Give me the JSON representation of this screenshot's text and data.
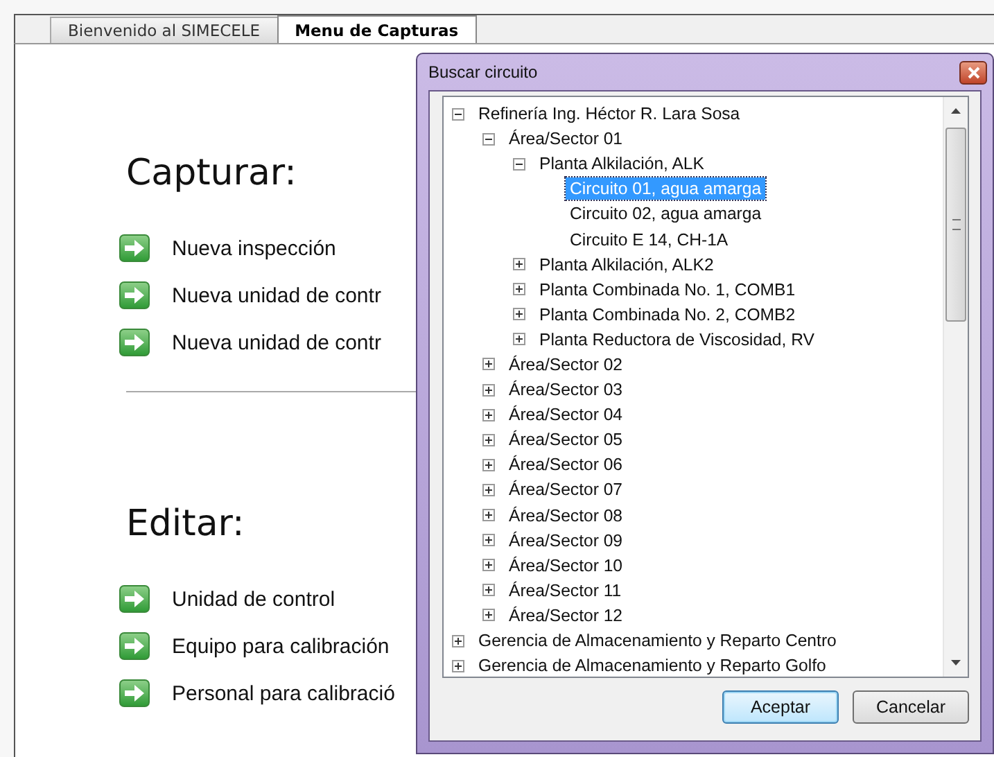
{
  "tabs": [
    {
      "label": "Bienvenido al SIMECELE",
      "selected": false
    },
    {
      "label": "Menu de Capturas",
      "selected": true
    }
  ],
  "sections": [
    {
      "title": "Capturar:",
      "items": [
        "Nueva inspección",
        "Nueva unidad de contr",
        "Nueva unidad de contr"
      ]
    },
    {
      "title": "Editar:",
      "items": [
        "Unidad de control",
        "Equipo para calibración",
        "Personal para calibració"
      ]
    }
  ],
  "dialog": {
    "title": "Buscar circuito",
    "tree": [
      {
        "label": "Refinería Ing. Héctor R. Lara Sosa",
        "expanded": true,
        "selected": false,
        "children": [
          {
            "label": "Área/Sector 01",
            "expanded": true,
            "selected": false,
            "children": [
              {
                "label": "Planta Alkilación, ALK",
                "expanded": true,
                "selected": false,
                "children": [
                  {
                    "label": "Circuito 01, agua amarga",
                    "selected": true
                  },
                  {
                    "label": "Circuito 02, agua amarga",
                    "selected": false
                  },
                  {
                    "label": "Circuito E 14, CH-1A",
                    "selected": false
                  }
                ]
              },
              {
                "label": "Planta Alkilación, ALK2",
                "expanded": false,
                "selected": false
              },
              {
                "label": "Planta Combinada No. 1, COMB1",
                "expanded": false,
                "selected": false
              },
              {
                "label": "Planta Combinada No. 2, COMB2",
                "expanded": false,
                "selected": false
              },
              {
                "label": "Planta Reductora de Viscosidad, RV",
                "expanded": false,
                "selected": false
              }
            ]
          },
          {
            "label": "Área/Sector 02",
            "expanded": false,
            "selected": false
          },
          {
            "label": "Área/Sector 03",
            "expanded": false,
            "selected": false
          },
          {
            "label": "Área/Sector 04",
            "expanded": false,
            "selected": false
          },
          {
            "label": "Área/Sector 05",
            "expanded": false,
            "selected": false
          },
          {
            "label": "Área/Sector 06",
            "expanded": false,
            "selected": false
          },
          {
            "label": "Área/Sector 07",
            "expanded": false,
            "selected": false
          },
          {
            "label": "Área/Sector 08",
            "expanded": false,
            "selected": false
          },
          {
            "label": "Área/Sector 09",
            "expanded": false,
            "selected": false
          },
          {
            "label": "Área/Sector 10",
            "expanded": false,
            "selected": false
          },
          {
            "label": "Área/Sector 11",
            "expanded": false,
            "selected": false
          },
          {
            "label": "Área/Sector 12",
            "expanded": false,
            "selected": false
          }
        ]
      },
      {
        "label": "Gerencia de Almacenamiento y Reparto Centro",
        "expanded": false,
        "selected": false
      },
      {
        "label": "Gerencia de Almacenamiento y Reparto Golfo",
        "expanded": false,
        "selected": false
      }
    ],
    "buttons": [
      "Aceptar",
      "Cancelar"
    ]
  }
}
